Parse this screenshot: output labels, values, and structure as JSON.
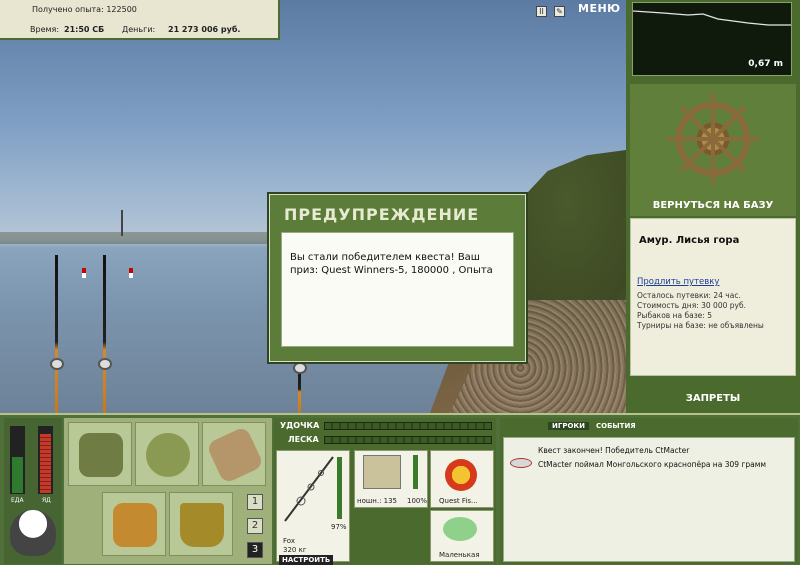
{
  "info": {
    "exp_label": "Получено опыта:",
    "exp_value": "122500",
    "time_label": "Время:",
    "time_value": "21:50 СБ",
    "money_label": "Деньги:",
    "money_value": "21 273 006 руб."
  },
  "toolbar": {
    "menu_label": "МЕНЮ",
    "icon_a": "II",
    "icon_b": "✎"
  },
  "depth": {
    "value": "0,67 m"
  },
  "right": {
    "return_label": "ВЕРНУТЬСЯ НА БАЗУ",
    "location_title": "Амур. Лисья гора",
    "extend_link": "Продлить путевку",
    "lines": [
      "Осталось путевки: 24 час.",
      "Стоимость дня: 30 000 руб.",
      "Рыбаков на базе: 5",
      "Турниры на базе: не объявлены"
    ],
    "bans_label": "ЗАПРЕТЫ"
  },
  "dialog": {
    "title": "ПРЕДУПРЕЖДЕНИЕ",
    "body": "Вы стали победителем квеста! Ваш приз: Quest Winners-5, 180000 , Опыта"
  },
  "meters": {
    "food_label": "ЕДА",
    "poison_label": "ЯД",
    "food_level": 0.55,
    "poison_level": 0.9
  },
  "inventory": {
    "pages": [
      "1",
      "2",
      "3"
    ],
    "active_page": "3"
  },
  "tackle": {
    "rod_label": "УДОЧКА",
    "line_label": "ЛЕСКА",
    "rod_name": "Fox",
    "rod_capacity": "320 кг",
    "rod_percent": "97%",
    "reel_text": "ношн.: 135",
    "reel_percent": "100%",
    "lure_name": "Quest Fis...",
    "bait_name": "Маленькая",
    "setup_label": "НАСТРОИТЬ"
  },
  "chat": {
    "tab_players": "ИГРОКИ",
    "tab_events": "СОБЫТИЯ",
    "lines": [
      "Квест закончен! Победитель CtMacter",
      "CtMacter поймал Монгольского краснопёра на 309 грамм"
    ]
  }
}
